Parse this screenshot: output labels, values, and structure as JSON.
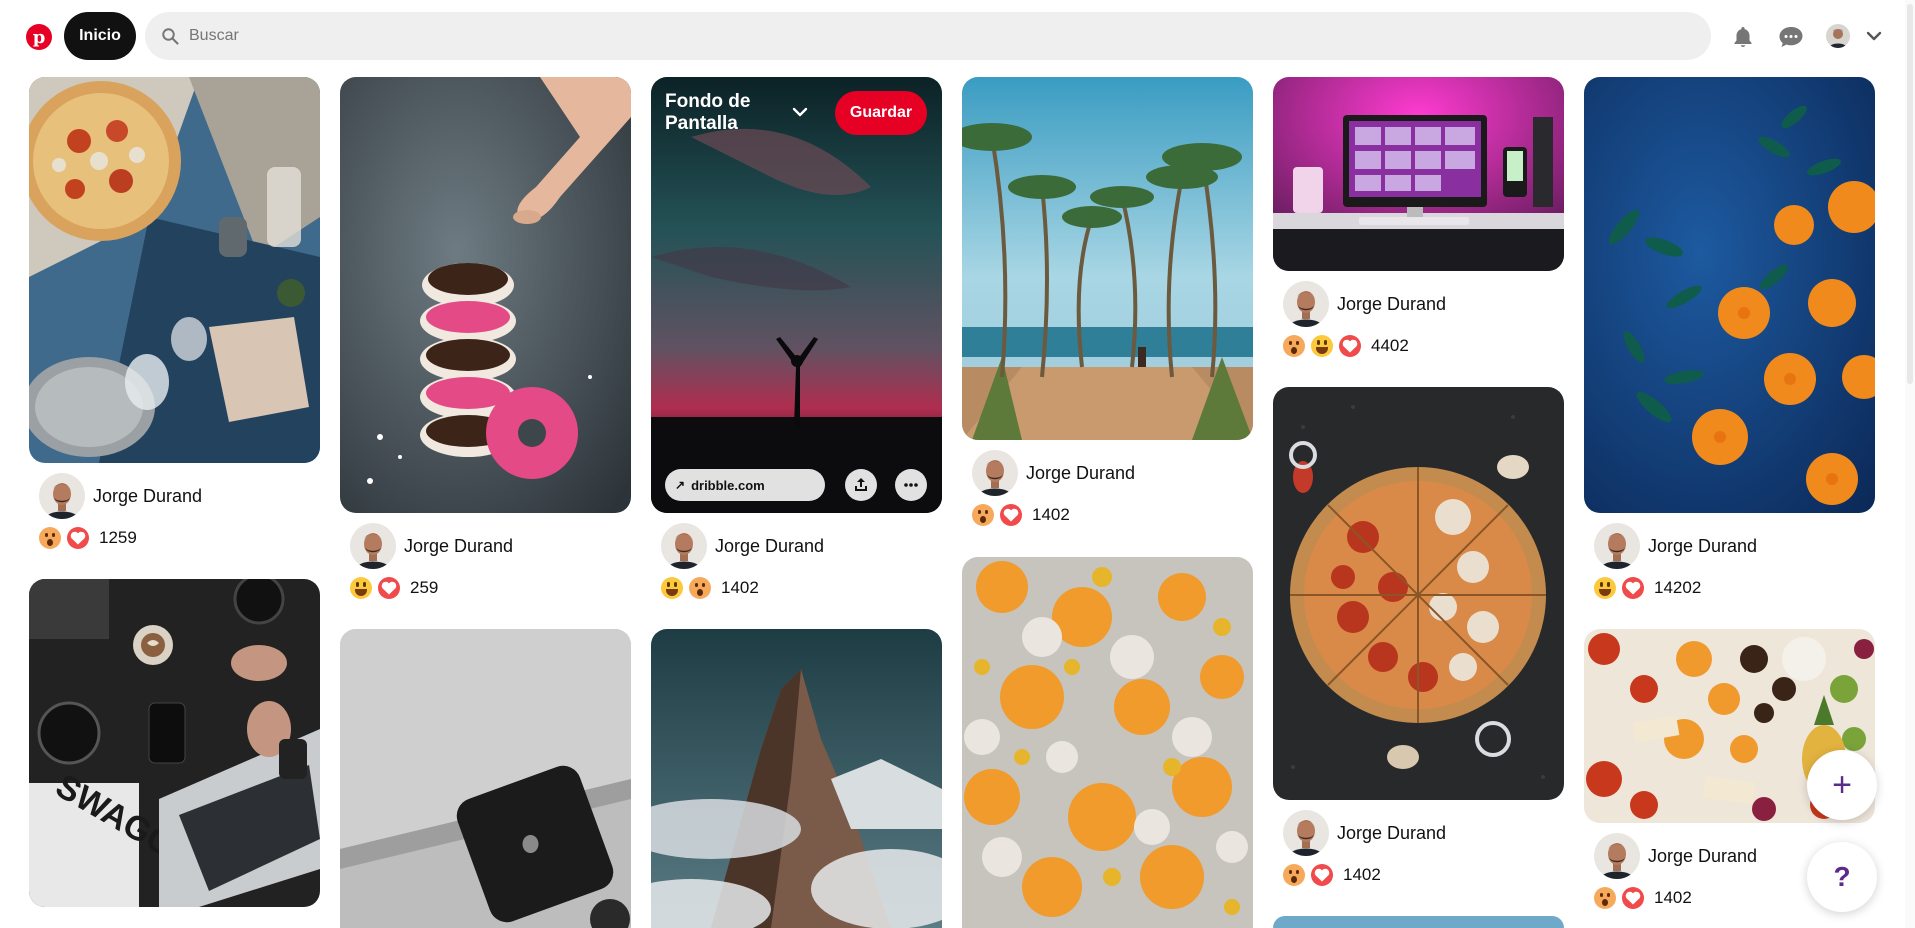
{
  "header": {
    "logo_letter": "p",
    "home_label": "Inicio",
    "search_placeholder": "Buscar",
    "icons": [
      "notifications-icon",
      "messages-icon",
      "account-chevron-icon"
    ]
  },
  "author_name": "Jorge Durand",
  "pins": [
    {
      "id": "pin-pizza-table",
      "reactions": [
        "wow",
        "love"
      ],
      "count": "1259"
    },
    {
      "id": "pin-donuts",
      "reactions": [
        "haha",
        "love"
      ],
      "count": "259"
    },
    {
      "id": "pin-sunset",
      "reactions": [
        "haha",
        "wow"
      ],
      "count": "1402",
      "overlay": {
        "board": "Fondo de Pantalla",
        "save": "Guardar",
        "link": "dribble.com"
      }
    },
    {
      "id": "pin-palms",
      "reactions": [
        "wow",
        "love"
      ],
      "count": "1402"
    },
    {
      "id": "pin-desk-setup",
      "reactions": [
        "wow",
        "haha",
        "love"
      ],
      "count": "4402"
    },
    {
      "id": "pin-oranges",
      "reactions": [
        "haha",
        "love"
      ],
      "count": "14202"
    },
    {
      "id": "pin-pizza-dark",
      "reactions": [
        "wow",
        "love"
      ],
      "count": "1402"
    },
    {
      "id": "pin-food-spread",
      "reactions": [
        "wow",
        "love"
      ],
      "count": "1402"
    }
  ],
  "fabs": {
    "add": "+",
    "help": "?"
  },
  "colors": {
    "brand": "#e60023",
    "header_search_bg": "#efefef",
    "fab_icon": "#5b2a8a"
  }
}
